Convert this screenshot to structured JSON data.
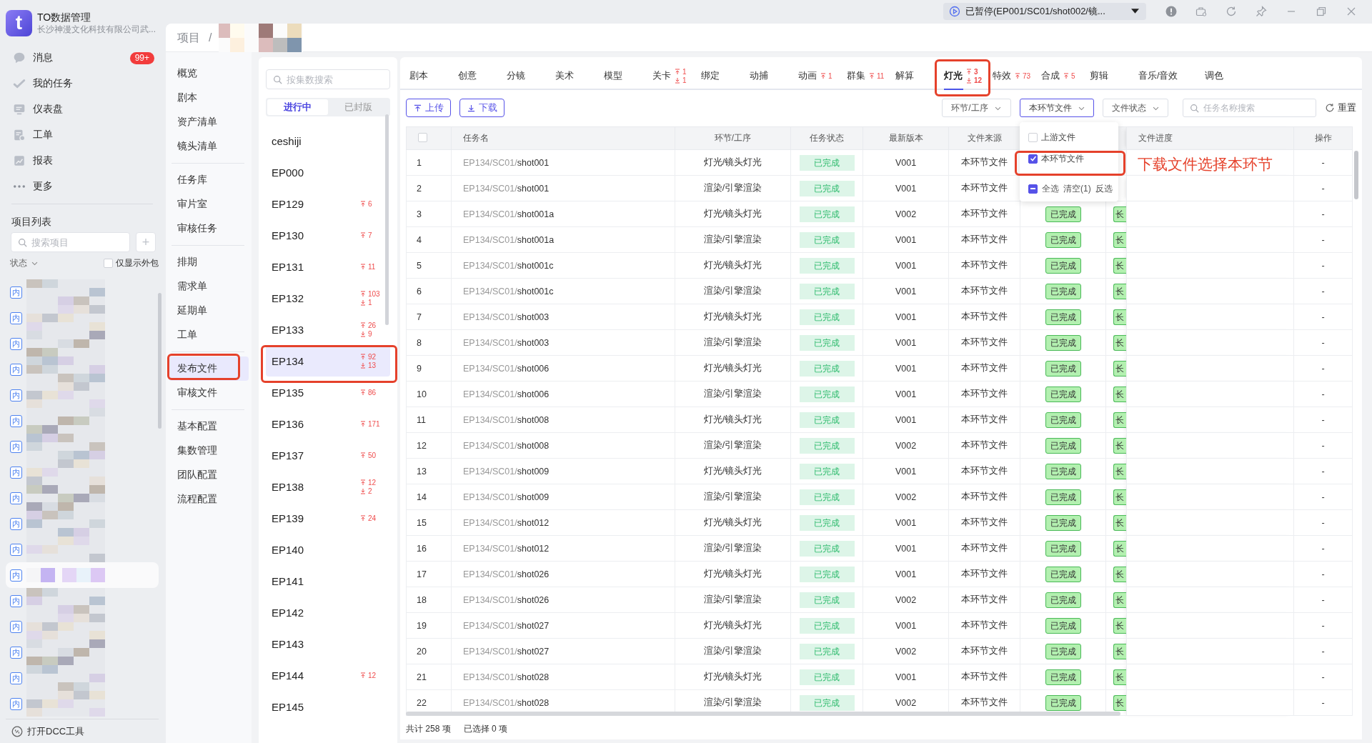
{
  "app": {
    "logo_text": "t",
    "title": "TO数据管理",
    "subtitle": "长沙神漫文化科技有限公司武..."
  },
  "sidebar": {
    "items": [
      {
        "label": "消息",
        "badge": "99+"
      },
      {
        "label": "我的任务"
      },
      {
        "label": "仪表盘"
      },
      {
        "label": "工单"
      },
      {
        "label": "报表"
      },
      {
        "label": "更多"
      }
    ],
    "project_list": {
      "title": "项目列表",
      "search": {
        "placeholder": "搜索项目"
      },
      "add": "+",
      "status_filter": "状态",
      "outsource_only": {
        "label": "仅显示外包",
        "checked": false
      },
      "projects": [
        {
          "tag": "内",
          "selected": false
        },
        {
          "tag": "内",
          "selected": false
        },
        {
          "tag": "内",
          "selected": false
        },
        {
          "tag": "内",
          "selected": false
        },
        {
          "tag": "内",
          "selected": false
        },
        {
          "tag": "内",
          "selected": false
        },
        {
          "tag": "内",
          "selected": false
        },
        {
          "tag": "内",
          "selected": false
        },
        {
          "tag": "内",
          "selected": false
        },
        {
          "tag": "内",
          "selected": false
        },
        {
          "tag": "内",
          "selected": false
        },
        {
          "tag": "内",
          "selected": true
        },
        {
          "tag": "内",
          "selected": false
        },
        {
          "tag": "内",
          "selected": false
        },
        {
          "tag": "内",
          "selected": false
        },
        {
          "tag": "内",
          "selected": false
        },
        {
          "tag": "内",
          "selected": false
        }
      ]
    },
    "dcc_tool": "打开DCC工具"
  },
  "titlebar": {
    "task_status": "已暂停(EP001/SC01/shot002/镜..."
  },
  "breadcrumb": {
    "root": "项目",
    "separator": "/"
  },
  "nav": {
    "groups": [
      {
        "items": [
          {
            "label": "概览",
            "selected": false
          },
          {
            "label": "剧本",
            "selected": false
          },
          {
            "label": "资产清单",
            "selected": false
          },
          {
            "label": "镜头清单",
            "selected": false
          }
        ]
      },
      {
        "items": [
          {
            "label": "任务库",
            "selected": false
          },
          {
            "label": "审片室",
            "selected": false
          },
          {
            "label": "审核任务",
            "selected": false
          }
        ]
      },
      {
        "items": [
          {
            "label": "排期",
            "selected": false
          },
          {
            "label": "需求单",
            "selected": false
          },
          {
            "label": "延期单",
            "selected": false
          },
          {
            "label": "工单",
            "selected": false
          }
        ]
      },
      {
        "items": [
          {
            "label": "发布文件",
            "selected": true
          },
          {
            "label": "审核文件",
            "selected": false
          }
        ]
      },
      {
        "items": [
          {
            "label": "基本配置",
            "selected": false
          },
          {
            "label": "集数管理",
            "selected": false
          },
          {
            "label": "团队配置",
            "selected": false
          },
          {
            "label": "流程配置",
            "selected": false
          }
        ]
      }
    ]
  },
  "episodes": {
    "search": {
      "placeholder": "按集数搜索"
    },
    "segments": [
      {
        "label": "进行中",
        "selected": true
      },
      {
        "label": "已封版",
        "selected": false
      }
    ],
    "items": [
      {
        "name": "ceshiji",
        "selected": false
      },
      {
        "name": "EP000",
        "selected": false
      },
      {
        "name": "EP129",
        "up": "6",
        "selected": false
      },
      {
        "name": "EP130",
        "up": "7",
        "selected": false
      },
      {
        "name": "EP131",
        "up": "11",
        "selected": false
      },
      {
        "name": "EP132",
        "up": "103",
        "down": "1",
        "selected": false
      },
      {
        "name": "EP133",
        "up": "26",
        "down": "9",
        "selected": false
      },
      {
        "name": "EP134",
        "up": "92",
        "down": "13",
        "selected": true
      },
      {
        "name": "EP135",
        "up": "86",
        "selected": false
      },
      {
        "name": "EP136",
        "up": "171",
        "selected": false
      },
      {
        "name": "EP137",
        "up": "50",
        "selected": false
      },
      {
        "name": "EP138",
        "up": "12",
        "down": "2",
        "selected": false
      },
      {
        "name": "EP139",
        "up": "24",
        "selected": false
      },
      {
        "name": "EP140",
        "selected": false
      },
      {
        "name": "EP141",
        "selected": false
      },
      {
        "name": "EP142",
        "selected": false
      },
      {
        "name": "EP143",
        "selected": false
      },
      {
        "name": "EP144",
        "up": "12",
        "selected": false
      },
      {
        "name": "EP145",
        "selected": false
      }
    ]
  },
  "content": {
    "tabs": [
      {
        "label": "剧本",
        "selected": false
      },
      {
        "label": "创意",
        "selected": false
      },
      {
        "label": "分镜",
        "selected": false
      },
      {
        "label": "美术",
        "selected": false
      },
      {
        "label": "模型",
        "selected": false
      },
      {
        "label": "关卡",
        "up": "1",
        "down": "1",
        "selected": false
      },
      {
        "label": "绑定",
        "selected": false
      },
      {
        "label": "动捕",
        "selected": false
      },
      {
        "label": "动画",
        "up": "1",
        "selected": false
      },
      {
        "label": "群集",
        "up": "11",
        "selected": false
      },
      {
        "label": "解算",
        "selected": false
      },
      {
        "label": "灯光",
        "up": "3",
        "down": "12",
        "selected": true
      },
      {
        "label": "特效",
        "up": "73",
        "selected": false
      },
      {
        "label": "合成",
        "up": "5",
        "selected": false
      },
      {
        "label": "剪辑",
        "selected": false
      },
      {
        "label": "音乐/音效",
        "selected": false
      },
      {
        "label": "调色",
        "selected": false
      }
    ],
    "upload": "上传",
    "download": "下载",
    "filters": [
      {
        "label": "环节/工序",
        "open": false
      },
      {
        "label": "本环节文件",
        "open": true
      },
      {
        "label": "文件状态",
        "open": false
      }
    ],
    "search": {
      "placeholder": "任务名称搜索"
    },
    "reset": "重置",
    "dropdown": {
      "options": [
        {
          "label": "上游文件",
          "checked": false
        },
        {
          "label": "本环节文件",
          "checked": true
        }
      ],
      "select_all": {
        "label": "全选",
        "indeterminate": true
      },
      "clear": "清空(1)",
      "invert": "反选"
    },
    "table": {
      "select_all_checked": false,
      "columns": [
        "任务名",
        "环节/工序",
        "任务状态",
        "最新版本",
        "文件来源",
        "文件进度",
        "操作"
      ],
      "rows": [
        {
          "index": "1",
          "path": "EP134/SC01/",
          "shot": "shot001",
          "step": "灯光/镜头灯光",
          "status": "已完成",
          "version": "V001",
          "source": "本环节文件",
          "action": "-"
        },
        {
          "index": "2",
          "path": "EP134/SC01/",
          "shot": "shot001",
          "step": "渲染/引擎渲染",
          "status": "已完成",
          "version": "V001",
          "source": "本环节文件",
          "action": "-"
        },
        {
          "index": "3",
          "path": "EP134/SC01/",
          "shot": "shot001a",
          "step": "灯光/镜头灯光",
          "status": "已完成",
          "version": "V002",
          "source": "本环节文件",
          "column_7": "已完成",
          "column_8": "长",
          "action": "-"
        },
        {
          "index": "4",
          "path": "EP134/SC01/",
          "shot": "shot001a",
          "step": "渲染/引擎渲染",
          "status": "已完成",
          "version": "V001",
          "source": "本环节文件",
          "column_7": "已完成",
          "column_8": "长",
          "action": "-"
        },
        {
          "index": "5",
          "path": "EP134/SC01/",
          "shot": "shot001c",
          "step": "灯光/镜头灯光",
          "status": "已完成",
          "version": "V001",
          "source": "本环节文件",
          "column_7": "已完成",
          "column_8": "长",
          "action": "-"
        },
        {
          "index": "6",
          "path": "EP134/SC01/",
          "shot": "shot001c",
          "step": "渲染/引擎渲染",
          "status": "已完成",
          "version": "V001",
          "source": "本环节文件",
          "column_7": "已完成",
          "column_8": "长",
          "action": "-"
        },
        {
          "index": "7",
          "path": "EP134/SC01/",
          "shot": "shot003",
          "step": "灯光/镜头灯光",
          "status": "已完成",
          "version": "V001",
          "source": "本环节文件",
          "column_7": "已完成",
          "column_8": "长",
          "action": "-"
        },
        {
          "index": "8",
          "path": "EP134/SC01/",
          "shot": "shot003",
          "step": "渲染/引擎渲染",
          "status": "已完成",
          "version": "V001",
          "source": "本环节文件",
          "column_7": "已完成",
          "column_8": "长",
          "action": "-"
        },
        {
          "index": "9",
          "path": "EP134/SC01/",
          "shot": "shot006",
          "step": "灯光/镜头灯光",
          "status": "已完成",
          "version": "V001",
          "source": "本环节文件",
          "column_7": "已完成",
          "column_8": "长",
          "action": "-"
        },
        {
          "index": "10",
          "path": "EP134/SC01/",
          "shot": "shot006",
          "step": "渲染/引擎渲染",
          "status": "已完成",
          "version": "V001",
          "source": "本环节文件",
          "column_7": "已完成",
          "column_8": "长",
          "action": "-"
        },
        {
          "index": "11",
          "path": "EP134/SC01/",
          "shot": "shot008",
          "step": "灯光/镜头灯光",
          "status": "已完成",
          "version": "V001",
          "source": "本环节文件",
          "column_7": "已完成",
          "column_8": "长",
          "action": "-"
        },
        {
          "index": "12",
          "path": "EP134/SC01/",
          "shot": "shot008",
          "step": "渲染/引擎渲染",
          "status": "已完成",
          "version": "V002",
          "source": "本环节文件",
          "column_7": "已完成",
          "column_8": "长",
          "action": "-"
        },
        {
          "index": "13",
          "path": "EP134/SC01/",
          "shot": "shot009",
          "step": "灯光/镜头灯光",
          "status": "已完成",
          "version": "V001",
          "source": "本环节文件",
          "column_7": "已完成",
          "column_8": "长",
          "action": "-"
        },
        {
          "index": "14",
          "path": "EP134/SC01/",
          "shot": "shot009",
          "step": "渲染/引擎渲染",
          "status": "已完成",
          "version": "V002",
          "source": "本环节文件",
          "column_7": "已完成",
          "column_8": "长",
          "action": "-"
        },
        {
          "index": "15",
          "path": "EP134/SC01/",
          "shot": "shot012",
          "step": "灯光/镜头灯光",
          "status": "已完成",
          "version": "V001",
          "source": "本环节文件",
          "column_7": "已完成",
          "column_8": "长",
          "action": "-"
        },
        {
          "index": "16",
          "path": "EP134/SC01/",
          "shot": "shot012",
          "step": "渲染/引擎渲染",
          "status": "已完成",
          "version": "V001",
          "source": "本环节文件",
          "column_7": "已完成",
          "column_8": "长",
          "action": "-"
        },
        {
          "index": "17",
          "path": "EP134/SC01/",
          "shot": "shot026",
          "step": "灯光/镜头灯光",
          "status": "已完成",
          "version": "V001",
          "source": "本环节文件",
          "column_7": "已完成",
          "column_8": "长",
          "action": "-"
        },
        {
          "index": "18",
          "path": "EP134/SC01/",
          "shot": "shot026",
          "step": "渲染/引擎渲染",
          "status": "已完成",
          "version": "V002",
          "source": "本环节文件",
          "column_7": "已完成",
          "column_8": "长",
          "action": "-"
        },
        {
          "index": "19",
          "path": "EP134/SC01/",
          "shot": "shot027",
          "step": "灯光/镜头灯光",
          "status": "已完成",
          "version": "V001",
          "source": "本环节文件",
          "column_7": "已完成",
          "column_8": "长",
          "action": "-"
        },
        {
          "index": "20",
          "path": "EP134/SC01/",
          "shot": "shot027",
          "step": "渲染/引擎渲染",
          "status": "已完成",
          "version": "V002",
          "source": "本环节文件",
          "column_7": "已完成",
          "column_8": "长",
          "action": "-"
        },
        {
          "index": "21",
          "path": "EP134/SC01/",
          "shot": "shot028",
          "step": "灯光/镜头灯光",
          "status": "已完成",
          "version": "V001",
          "source": "本环节文件",
          "column_7": "已完成",
          "column_8": "长",
          "action": "-"
        },
        {
          "index": "22",
          "path": "EP134/SC01/",
          "shot": "shot028",
          "step": "渲染/引擎渲染",
          "status": "已完成",
          "version": "V002",
          "source": "本环节文件",
          "column_7": "已完成",
          "column_8": "长",
          "action": "-"
        }
      ]
    },
    "footer": {
      "total": "共计 258 项",
      "selected": "已选择 0 项"
    }
  },
  "annotation": {
    "note": "下载文件选择本环节"
  }
}
